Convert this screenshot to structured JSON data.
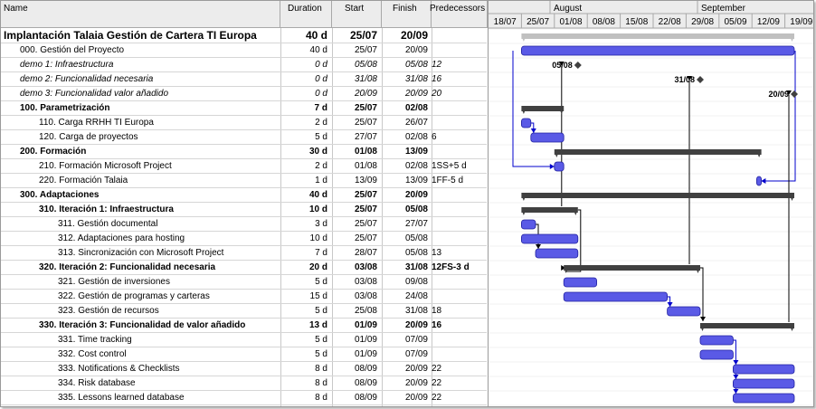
{
  "columns": {
    "name": "Name",
    "duration": "Duration",
    "start": "Start",
    "finish": "Finish",
    "predecessors": "Predecessors"
  },
  "timescale": {
    "months": [
      {
        "label": "August"
      },
      {
        "label": "September"
      }
    ],
    "days": [
      "18/07",
      "25/07",
      "01/08",
      "08/08",
      "15/08",
      "22/08",
      "29/08",
      "05/09",
      "12/09",
      "19/09"
    ]
  },
  "colors": {
    "task_bar": "#5a5ae6",
    "task_bar_border": "#2020a0",
    "summary_bar": "#404040",
    "link_line": "#0000cc",
    "header_bg": "#ececec"
  },
  "tasks": [
    {
      "name": "Implantación Talaia Gestión de Cartera TI Europa",
      "duration": "40 d",
      "start": "25/07",
      "finish": "20/09",
      "pred": "",
      "type": "project"
    },
    {
      "name": "000. Gestión del Proyecto",
      "duration": "40 d",
      "start": "25/07",
      "finish": "20/09",
      "pred": "",
      "type": "task"
    },
    {
      "name": "demo 1: Infraestructura",
      "duration": "0 d",
      "start": "05/08",
      "finish": "05/08",
      "pred": "12",
      "type": "milestone",
      "label": "05/08"
    },
    {
      "name": "demo 2: Funcionalidad necesaria",
      "duration": "0 d",
      "start": "31/08",
      "finish": "31/08",
      "pred": "16",
      "type": "milestone",
      "label": "31/08"
    },
    {
      "name": "demo 3: Funcionalidad valor añadido",
      "duration": "0 d",
      "start": "20/09",
      "finish": "20/09",
      "pred": "20",
      "type": "milestone",
      "label": "20/09"
    },
    {
      "name": "100. Parametrización",
      "duration": "7 d",
      "start": "25/07",
      "finish": "02/08",
      "pred": "",
      "type": "summary"
    },
    {
      "name": "110. Carga RRHH TI Europa",
      "duration": "2 d",
      "start": "25/07",
      "finish": "26/07",
      "pred": "",
      "type": "task"
    },
    {
      "name": "120. Carga de proyectos",
      "duration": "5 d",
      "start": "27/07",
      "finish": "02/08",
      "pred": "6",
      "type": "task"
    },
    {
      "name": "200. Formación",
      "duration": "30 d",
      "start": "01/08",
      "finish": "13/09",
      "pred": "",
      "type": "summary"
    },
    {
      "name": "210. Formación Microsoft Project",
      "duration": "2 d",
      "start": "01/08",
      "finish": "02/08",
      "pred": "1SS+5 d",
      "type": "task"
    },
    {
      "name": "220. Formación Talaia",
      "duration": "1 d",
      "start": "13/09",
      "finish": "13/09",
      "pred": "1FF-5 d",
      "type": "task"
    },
    {
      "name": "300. Adaptaciones",
      "duration": "40 d",
      "start": "25/07",
      "finish": "20/09",
      "pred": "",
      "type": "summary"
    },
    {
      "name": "310. Iteración 1: Infraestructura",
      "duration": "10 d",
      "start": "25/07",
      "finish": "05/08",
      "pred": "",
      "type": "summary"
    },
    {
      "name": "311. Gestión documental",
      "duration": "3 d",
      "start": "25/07",
      "finish": "27/07",
      "pred": "",
      "type": "task"
    },
    {
      "name": "312. Adaptaciones para hosting",
      "duration": "10 d",
      "start": "25/07",
      "finish": "05/08",
      "pred": "",
      "type": "task"
    },
    {
      "name": "313. Sincronización con Microsoft Project",
      "duration": "7 d",
      "start": "28/07",
      "finish": "05/08",
      "pred": "13",
      "type": "task"
    },
    {
      "name": "320. Iteración 2: Funcionalidad necesaria",
      "duration": "20 d",
      "start": "03/08",
      "finish": "31/08",
      "pred": "12FS-3 d",
      "type": "summary"
    },
    {
      "name": "321. Gestión de inversiones",
      "duration": "5 d",
      "start": "03/08",
      "finish": "09/08",
      "pred": "",
      "type": "task"
    },
    {
      "name": "322. Gestión de programas y carteras",
      "duration": "15 d",
      "start": "03/08",
      "finish": "24/08",
      "pred": "",
      "type": "task"
    },
    {
      "name": "323. Gestión de recursos",
      "duration": "5 d",
      "start": "25/08",
      "finish": "31/08",
      "pred": "18",
      "type": "task"
    },
    {
      "name": "330. Iteración 3: Funcionalidad de valor añadido",
      "duration": "13 d",
      "start": "01/09",
      "finish": "20/09",
      "pred": "16",
      "type": "summary"
    },
    {
      "name": "331. Time tracking",
      "duration": "5 d",
      "start": "01/09",
      "finish": "07/09",
      "pred": "",
      "type": "task"
    },
    {
      "name": "332. Cost control",
      "duration": "5 d",
      "start": "01/09",
      "finish": "07/09",
      "pred": "",
      "type": "task"
    },
    {
      "name": "333. Notifications & Checklists",
      "duration": "8 d",
      "start": "08/09",
      "finish": "20/09",
      "pred": "22",
      "type": "task"
    },
    {
      "name": "334. Risk database",
      "duration": "8 d",
      "start": "08/09",
      "finish": "20/09",
      "pred": "22",
      "type": "task"
    },
    {
      "name": "335. Lessons learned database",
      "duration": "8 d",
      "start": "08/09",
      "finish": "20/09",
      "pred": "22",
      "type": "task"
    }
  ]
}
